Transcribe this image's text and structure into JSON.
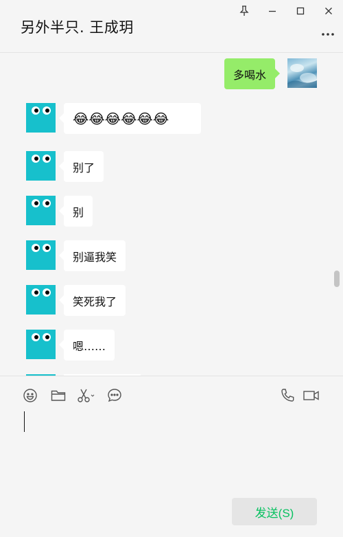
{
  "window": {
    "title": "另外半只. 王成玥",
    "controls": [
      "pin-icon",
      "minimize-icon",
      "maximize-icon",
      "close-icon"
    ],
    "more_icon": "more-dots-icon"
  },
  "messages": [
    {
      "direction": "outgoing",
      "text": "多喝水"
    },
    {
      "direction": "incoming",
      "text": "😂😂😂😂😂😂"
    },
    {
      "direction": "incoming",
      "text": "别了"
    },
    {
      "direction": "incoming",
      "text": "别"
    },
    {
      "direction": "incoming",
      "text": "别逼我笑"
    },
    {
      "direction": "incoming",
      "text": "笑死我了"
    },
    {
      "direction": "incoming",
      "text": "嗯……"
    }
  ],
  "toolbar": {
    "left_tools": [
      "emoji-icon",
      "folder-icon",
      "scissors-icon",
      "chat-bubble-icon"
    ],
    "right_tools": [
      "phone-icon",
      "video-icon"
    ]
  },
  "input": {
    "value": ""
  },
  "send_label": "发送(S)",
  "colors": {
    "outgoing_bubble": "#95ec69",
    "incoming_bubble": "#ffffff",
    "avatar": "#17c0cc",
    "send_text": "#07c160",
    "background": "#f5f5f5"
  }
}
